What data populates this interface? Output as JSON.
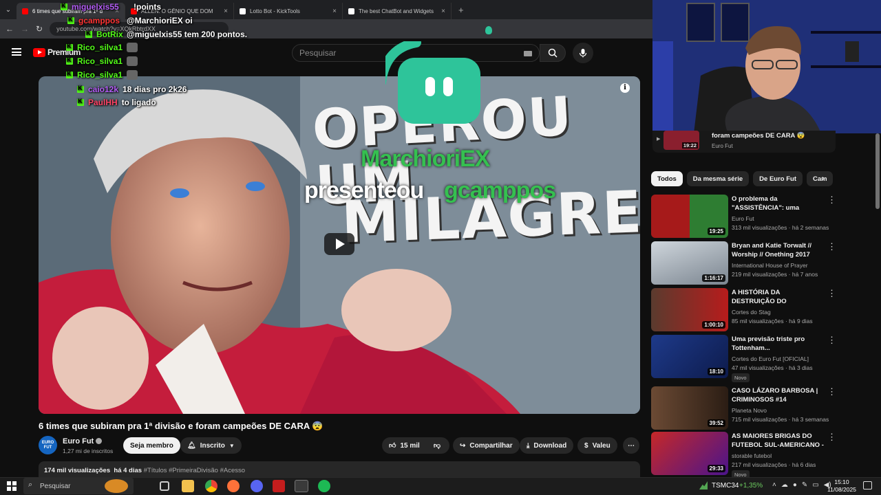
{
  "browser": {
    "tabs": [
      {
        "title": "6 times que subiram pra 1ª d",
        "color": "#ff0000"
      },
      {
        "title": "ALLEN: O GÊNIO QUE DOM",
        "color": "#ff0000"
      },
      {
        "title": "Lotto Bot - KickTools",
        "color": "#ffffff"
      },
      {
        "title": "The best ChatBot and Widgets",
        "color": "#ffffff"
      }
    ],
    "url": "youtube.com/watch?v=XQkRbtrdXX"
  },
  "youtube": {
    "logo_text": "Premium",
    "search_placeholder": "Pesquisar",
    "video_title": "6 times que subiram pra 1ª divisão e foram campeões DE CARA 😨",
    "thumbnail_text": {
      "line1": "OPEROU UM",
      "line2": "MILAGRE!"
    },
    "channel": {
      "name": "Euro Fut",
      "subs": "1,27 mi de inscritos",
      "avatar_text": "EURO FUT"
    },
    "buttons": {
      "member": "Seja membro",
      "subscribed": "Inscrito",
      "likes": "15 mil",
      "share": "Compartilhar",
      "download": "Download",
      "thanks": "Valeu"
    },
    "description": {
      "views": "174 mil visualizações",
      "date": "há 4 dias",
      "tags": "#Títulos #PrimeiraDivisão #Acesso"
    }
  },
  "overlay": {
    "gift_user": "MarchioriEX",
    "gift_text": "presenteou",
    "gift_target": "gcamppos",
    "chat": [
      {
        "user": "miguelxis55",
        "user_color": "#b35cf5",
        "msg": "!points"
      },
      {
        "user": "gcamppos",
        "user_color": "#ff3333",
        "msg": "@MarchioriEX oi"
      },
      {
        "user": "BotRix",
        "user_color": "#53fc18",
        "msg": "@miguelxis55 tem 200 pontos."
      },
      {
        "user": "Rico_silva1",
        "user_color": "#53fc18",
        "msg": ""
      },
      {
        "user": "Rico_silva1",
        "user_color": "#53fc18",
        "msg": ""
      },
      {
        "user": "Rico_silva1",
        "user_color": "#53fc18",
        "msg": ""
      },
      {
        "user": "caio12k",
        "user_color": "#b35cf5",
        "msg": "18 dias pro 2k26"
      },
      {
        "user": "PaulHH",
        "user_color": "#ff4466",
        "msg": "to ligado"
      }
    ]
  },
  "sidebar": {
    "playing_card": {
      "title": "foram campeões DE CARA 😨",
      "channel": "Euro Fut",
      "duration": "19:22"
    },
    "chips": [
      "Todos",
      "Da mesma série",
      "De Euro Fut",
      "Cam"
    ],
    "recs": [
      {
        "title": "O problema da \"ASSISTÊNCIA\": uma estatística mentirosa.",
        "channel": "Euro Fut",
        "meta": "313 mil visualizações · há 2 semanas",
        "duration": "19:25",
        "badge": "",
        "color": "#2e7d32"
      },
      {
        "title": "Bryan and Katie Torwalt // Worship // Onething 2017",
        "channel": "International House of Prayer",
        "meta": "219 mil visualizações · há 7 anos",
        "duration": "1:16:17",
        "badge": "",
        "color": "#9aa3ad"
      },
      {
        "title": "A HISTÓRIA DA DESTRUIÇÃO DO MANCHESTER UNITED! | ...",
        "channel": "Cortes do Stag",
        "meta": "85 mil visualizações · há 9 dias",
        "duration": "1:00:10",
        "badge": "",
        "color": "#b71c1c"
      },
      {
        "title": "Uma previsão triste pro Tottenham...",
        "channel": "Cortes do Euro Fut [OFICIAL]",
        "meta": "47 mil visualizações · há 3 dias",
        "duration": "18:10",
        "badge": "Novo",
        "color": "#1e3a8a"
      },
      {
        "title": "CASO LÁZARO BARBOSA | CRIMINOSOS #14",
        "channel": "Planeta Novo",
        "meta": "715 mil visualizações · há 3 semanas",
        "duration": "39:52",
        "badge": "",
        "color": "#4a3426"
      },
      {
        "title": "AS MAIORES BRIGAS DO FUTEBOL SUL-AMERICANO - ...",
        "channel": "storable futebol",
        "meta": "217 mil visualizações · há 6 dias",
        "duration": "29:33",
        "badge": "Novo",
        "color": "#c62828"
      }
    ]
  },
  "taskbar": {
    "search_placeholder": "Pesquisar",
    "stock": {
      "name": "TSMC34",
      "change": "+1,35%"
    },
    "time": "15:10",
    "date": "11/08/2025"
  },
  "colors": {
    "accent": "#ff0000",
    "kick": "#53fc18",
    "gift_green": "#35c050"
  }
}
